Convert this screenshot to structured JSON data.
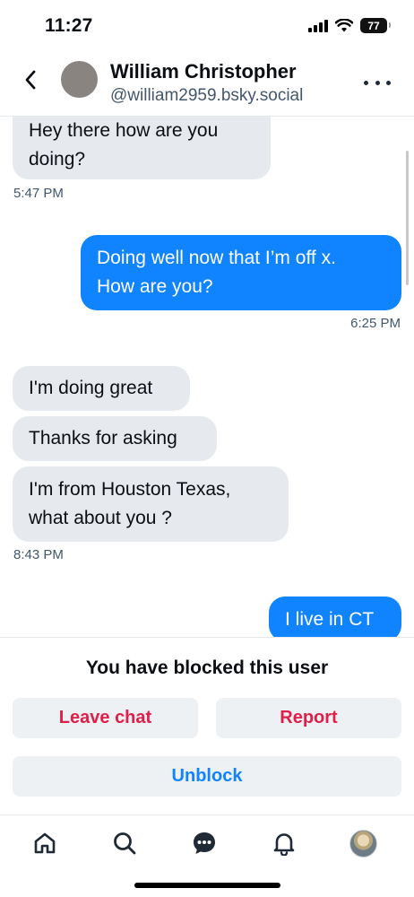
{
  "status_bar": {
    "time": "11:27",
    "battery": "77"
  },
  "header": {
    "name": "William Christopher",
    "handle": "@william2959.bsky.social",
    "back_icon": "chevron-left-icon",
    "more_icon": "ellipsis-icon"
  },
  "messages": [
    {
      "from": "them",
      "text": "Hey there how are you doing?"
    },
    {
      "from": "them",
      "kind": "time",
      "text": "5:47 PM"
    },
    {
      "from": "me",
      "text": "Doing well now that I’m off x. How are you?"
    },
    {
      "from": "me",
      "kind": "time",
      "text": "6:25 PM"
    },
    {
      "from": "them",
      "text": "I'm doing great"
    },
    {
      "from": "them",
      "text": "Thanks for asking"
    },
    {
      "from": "them",
      "text": "I'm from Houston Texas, what about you ?"
    },
    {
      "from": "them",
      "kind": "time",
      "text": "8:43 PM"
    },
    {
      "from": "me",
      "text": "I live in CT"
    }
  ],
  "chat": {
    "msg1_line1": "Hey there how are you",
    "msg1_line2": "doing?",
    "time1": "5:47 PM",
    "msg2_line1": "Doing well now that I’m off x.",
    "msg2_line2": "How are you?",
    "time2": "6:25 PM",
    "msg3": "I'm doing great",
    "msg4": "Thanks for asking",
    "msg5_line1": "I'm from Houston Texas,",
    "msg5_line2": "what about you ?",
    "time3": "8:43 PM",
    "msg6": "I live in CT"
  },
  "blocked": {
    "notice": "You have blocked this user",
    "leave_label": "Leave chat",
    "report_label": "Report",
    "unblock_label": "Unblock"
  },
  "tab_bar": {
    "tabs": [
      "home-icon",
      "search-icon",
      "chat-icon",
      "bell-icon",
      "profile-avatar"
    ],
    "active": "chat-icon"
  },
  "colors": {
    "accent": "#1083fe",
    "destructive": "#e01e4a",
    "incoming_bubble": "#e6eaee",
    "muted_text": "#42576c"
  }
}
